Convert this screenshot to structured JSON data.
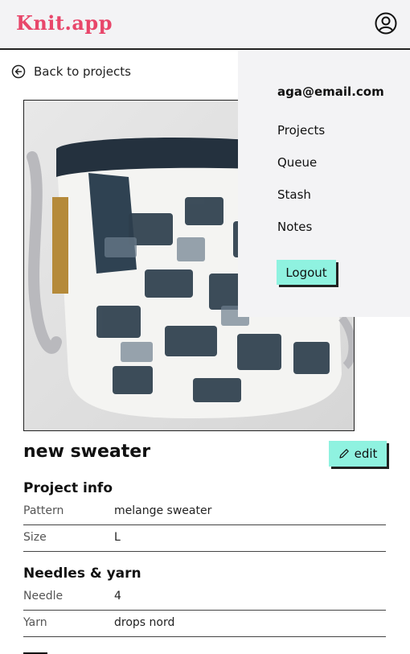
{
  "app": {
    "logo_text": "Knit.app"
  },
  "header": {
    "account_icon": "user-circle-icon"
  },
  "back": {
    "icon": "arrow-left-circle-icon",
    "label": "Back to projects"
  },
  "project": {
    "title": "new sweater",
    "edit_label": "edit",
    "edit_icon": "pencil-icon"
  },
  "project_info": {
    "heading": "Project info",
    "rows": [
      {
        "label": "Pattern",
        "value": "melange sweater"
      },
      {
        "label": "Size",
        "value": "L"
      }
    ]
  },
  "needles_yarn": {
    "heading": "Needles & yarn",
    "rows": [
      {
        "label": "Needle",
        "value": "4"
      },
      {
        "label": "Yarn",
        "value": "drops nord"
      }
    ]
  },
  "menu": {
    "email": "aga@email.com",
    "items": [
      {
        "label": "Projects"
      },
      {
        "label": "Queue"
      },
      {
        "label": "Stash"
      },
      {
        "label": "Notes"
      }
    ],
    "logout_label": "Logout"
  },
  "colors": {
    "accent": "#8ff2e0",
    "brand": "#e8466a",
    "header_bg": "#f3f3f5"
  }
}
